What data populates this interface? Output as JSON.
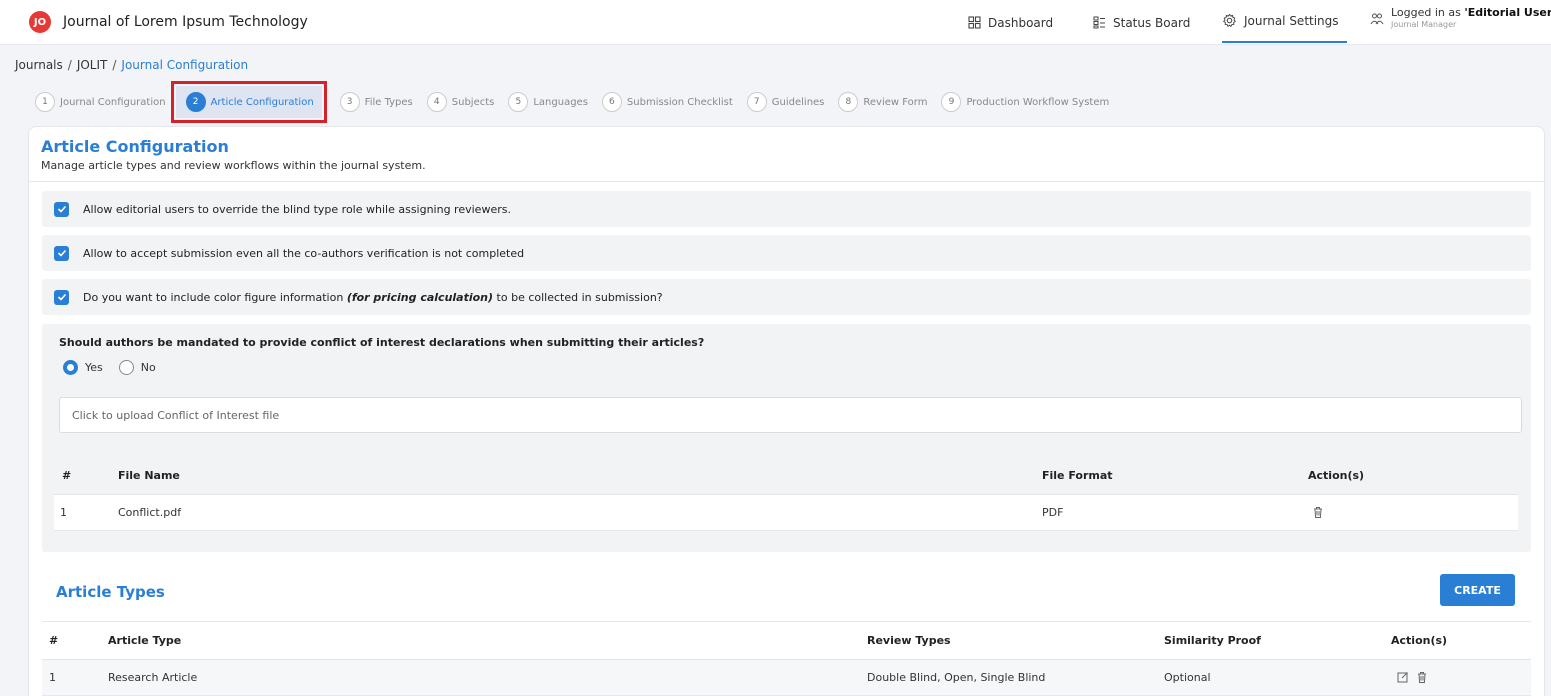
{
  "header": {
    "logo_text": "JO",
    "app_title": "Journal of Lorem Ipsum Technology",
    "nav": [
      {
        "label": "Dashboard",
        "icon": "grid-icon"
      },
      {
        "label": "Status Board",
        "icon": "board-icon"
      },
      {
        "label": "Journal Settings",
        "icon": "gear-icon",
        "active": true
      }
    ],
    "user": {
      "prefix": "Logged in as ",
      "name": "'Editorial User'",
      "role": "Journal Manager"
    }
  },
  "breadcrumb": [
    "Journals",
    "JOLIT",
    "Journal Configuration"
  ],
  "steps": [
    {
      "num": "1",
      "label": "Journal Configuration"
    },
    {
      "num": "2",
      "label": "Article Configuration"
    },
    {
      "num": "3",
      "label": "File Types"
    },
    {
      "num": "4",
      "label": "Subjects"
    },
    {
      "num": "5",
      "label": "Languages"
    },
    {
      "num": "6",
      "label": "Submission Checklist"
    },
    {
      "num": "7",
      "label": "Guidelines"
    },
    {
      "num": "8",
      "label": "Review Form"
    },
    {
      "num": "9",
      "label": "Production Workflow System"
    }
  ],
  "active_step": "2",
  "article_config": {
    "title": "Article Configuration",
    "subtitle": "Manage article types and review workflows within the journal system.",
    "options": [
      {
        "label": "Allow editorial users to override the blind type role while assigning reviewers.",
        "checked": true
      },
      {
        "label": "Allow to accept submission even all the co-authors verification is not completed",
        "checked": true
      },
      {
        "label_before": "Do you want to include color figure information ",
        "label_em": "(for pricing calculation)",
        "label_after": " to be collected in submission?",
        "checked": true
      }
    ],
    "coi": {
      "question": "Should authors be mandated to provide conflict of interest declarations when submitting their articles?",
      "yes_label": "Yes",
      "no_label": "No",
      "selected": "Yes",
      "upload_placeholder": "Click to upload Conflict of Interest file",
      "columns": [
        "#",
        "File Name",
        "File Format",
        "Action(s)"
      ],
      "rows": [
        {
          "index": "1",
          "file_name": "Conflict.pdf",
          "file_format": "PDF"
        }
      ]
    }
  },
  "article_types": {
    "title": "Article Types",
    "create_label": "CREATE",
    "columns": [
      "#",
      "Article Type",
      "Review Types",
      "Similarity Proof",
      "Action(s)"
    ],
    "rows": [
      {
        "index": "1",
        "article_type": "Research Article",
        "review_types": "Double Blind, Open, Single Blind",
        "similarity_proof": "Optional"
      }
    ]
  },
  "colors": {
    "accent": "#2a7fd4",
    "highlight_border": "#d2232a",
    "logo": "#e53935"
  }
}
